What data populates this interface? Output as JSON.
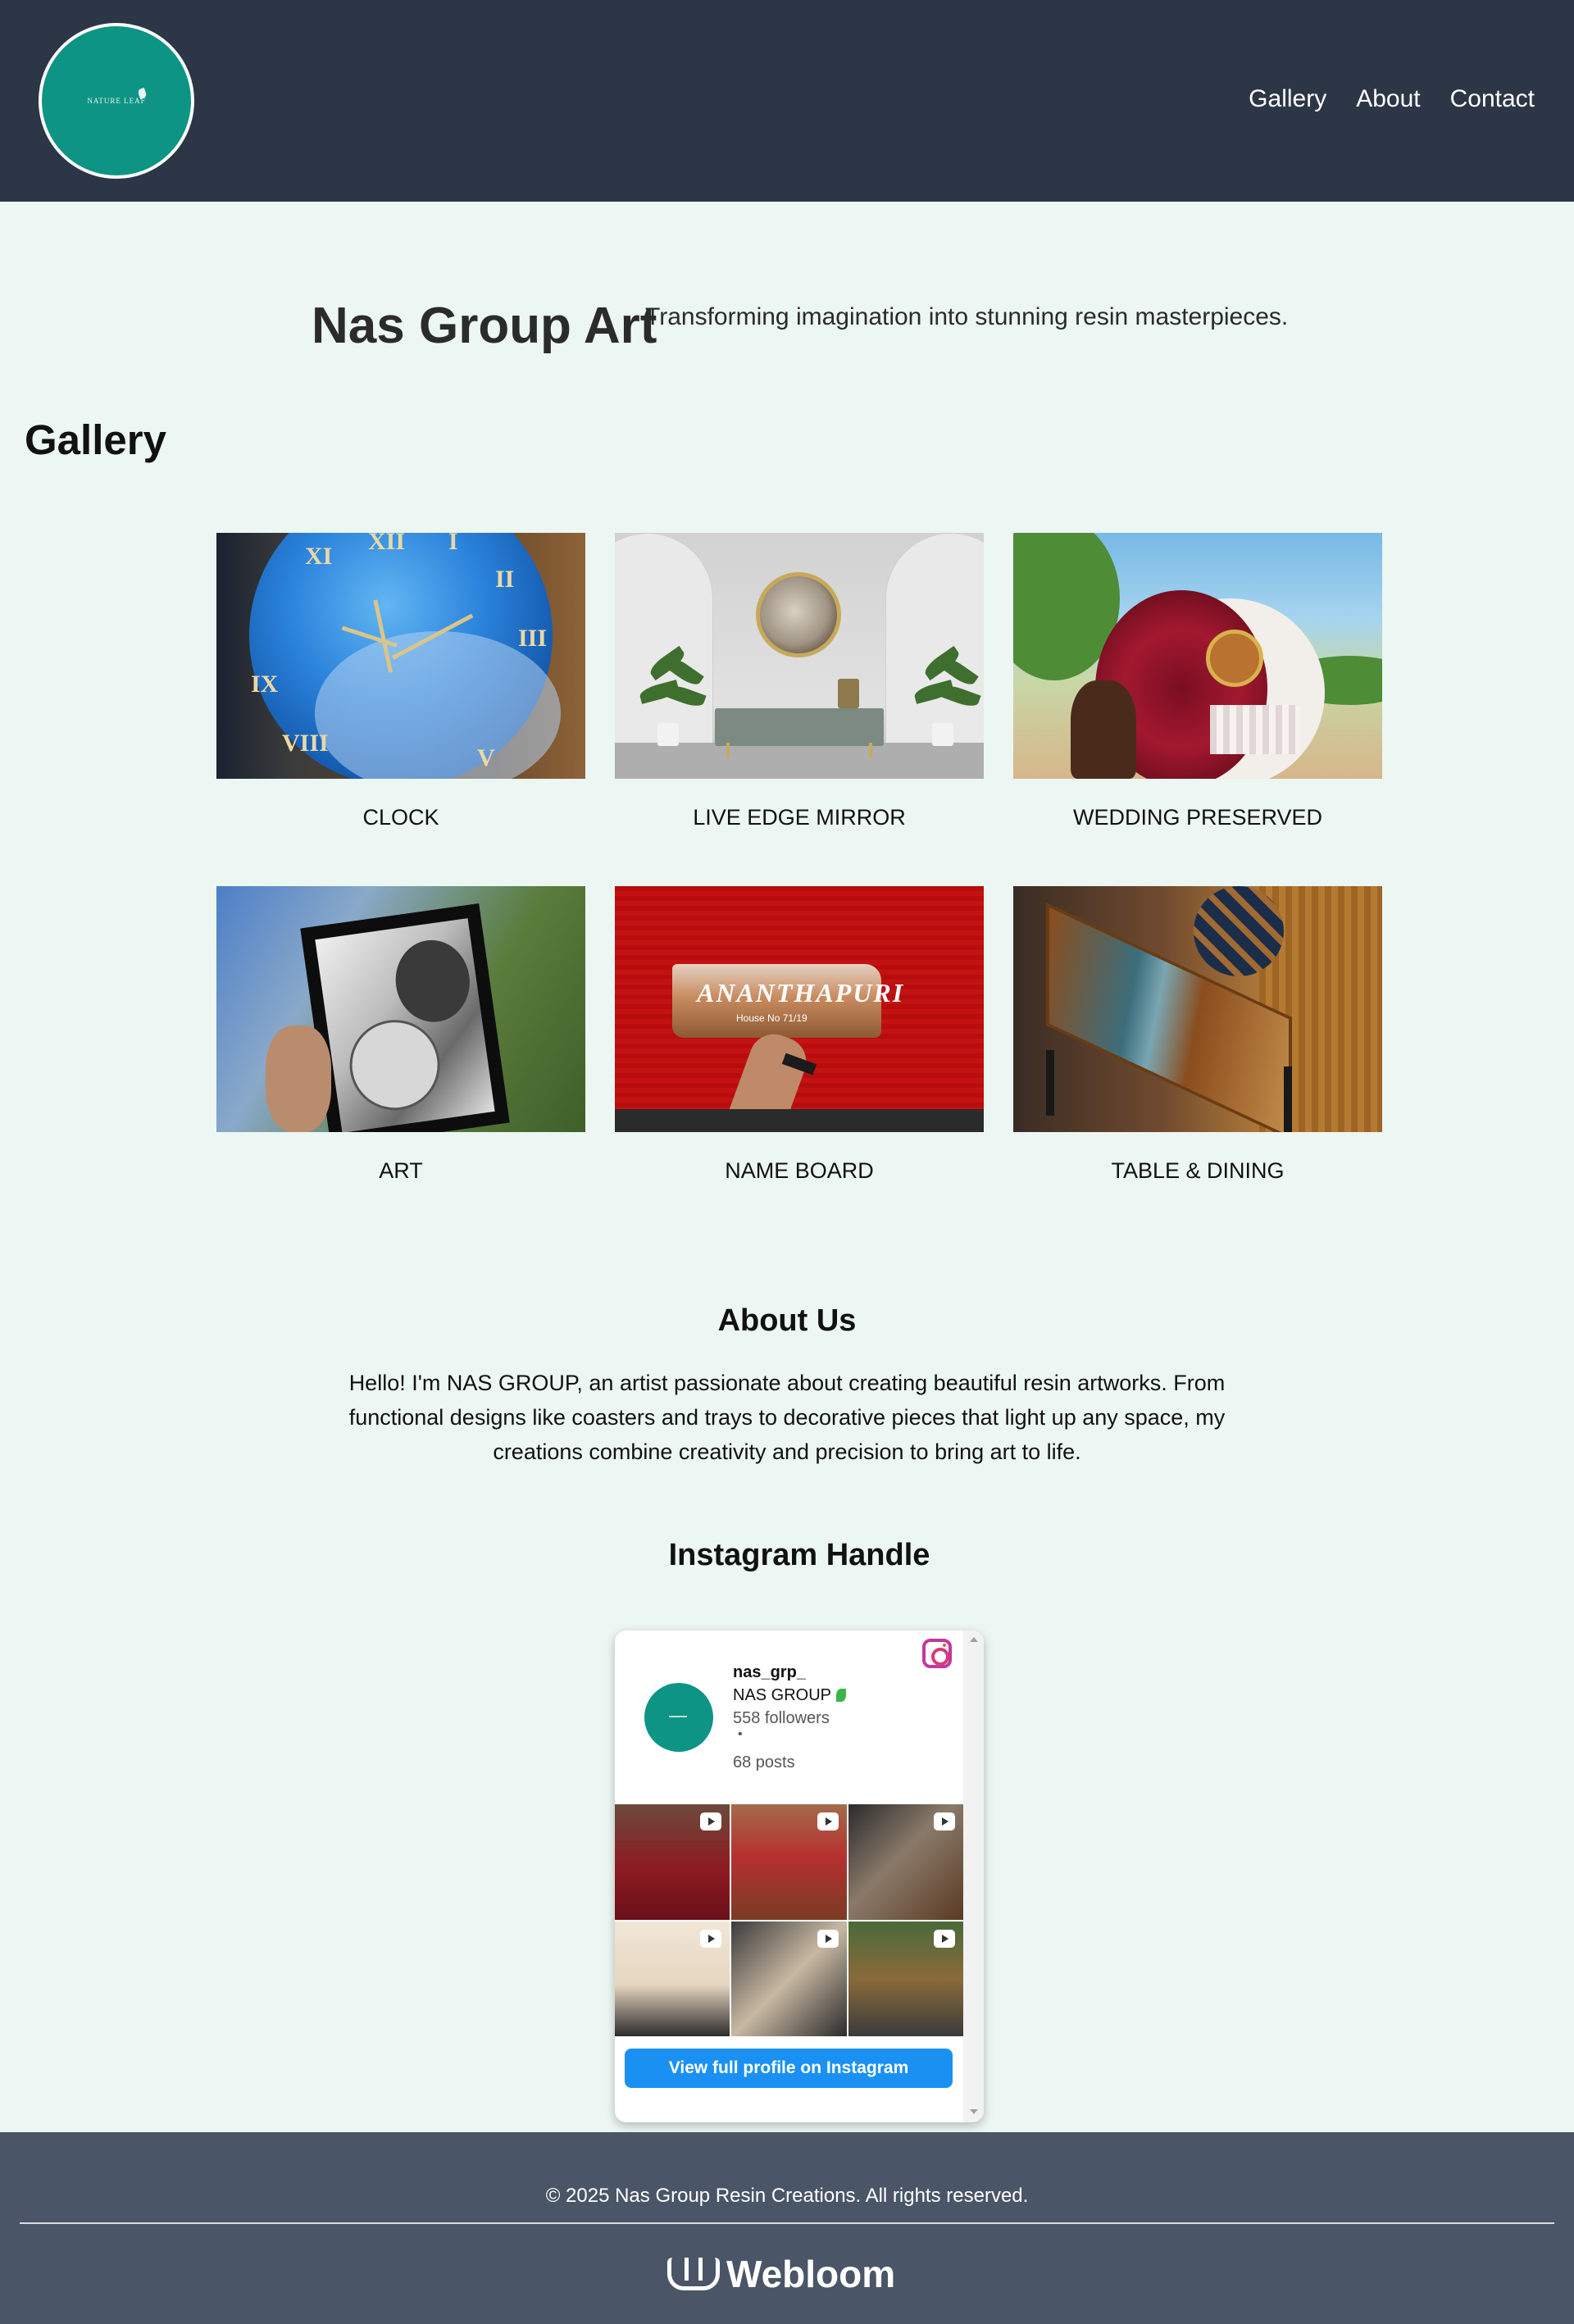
{
  "header": {
    "logo_text": "NATURE LEAF",
    "nav": [
      "Gallery",
      "About",
      "Contact"
    ]
  },
  "hero": {
    "title": "Nas Group Art",
    "tagline": "Transforming imagination into stunning resin masterpieces."
  },
  "gallery": {
    "heading": "Gallery",
    "items": [
      {
        "caption": "CLOCK"
      },
      {
        "caption": "LIVE EDGE MIRROR"
      },
      {
        "caption": "WEDDING PRESERVED"
      },
      {
        "caption": "ART"
      },
      {
        "caption": "NAME BOARD"
      },
      {
        "caption": "TABLE & DINING"
      }
    ],
    "clock_numerals": [
      "XII",
      "I",
      "II",
      "III",
      "IX",
      "VIII",
      "V",
      "XI"
    ],
    "name_board_text": "ANANTHAPURI",
    "name_board_sub": "House No 71/19"
  },
  "about": {
    "title": "About Us",
    "body": "Hello! I'm NAS GROUP, an artist passionate about creating beautiful resin artworks. From functional designs like coasters and trays to decorative pieces that light up any space, my creations combine creativity and precision to bring art to life."
  },
  "instagram": {
    "title": "Instagram Handle",
    "handle": "nas_grp_",
    "name": "NAS GROUP",
    "followers": "558 followers",
    "separator": "•",
    "posts": "68 posts",
    "button_label": "View full profile on Instagram"
  },
  "footer": {
    "copyright": "© 2025 Nas Group Resin Creations. All rights reserved.",
    "brand": "Webloom"
  },
  "colors": {
    "header_bg": "#2d3647",
    "page_bg": "#ecf6f2",
    "logo_teal": "#0e9484",
    "footer_bg": "#4a5567",
    "instagram_blue": "#1a91f2"
  }
}
